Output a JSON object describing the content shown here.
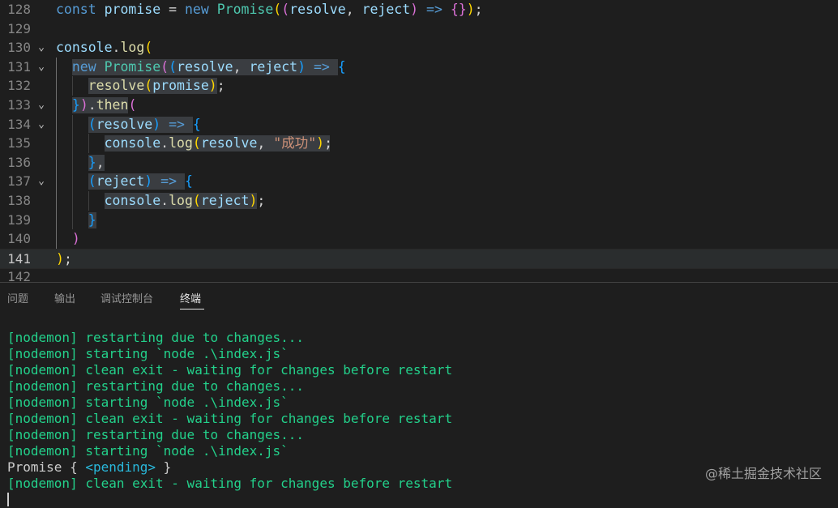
{
  "editor": {
    "lines": [
      {
        "n": "128",
        "parts": [
          [
            "k",
            "const "
          ],
          [
            "v",
            "promise"
          ],
          [
            "p",
            " = "
          ],
          [
            "k",
            "new "
          ],
          [
            "t",
            "Promise"
          ],
          [
            "b1",
            "("
          ],
          [
            "b2",
            "("
          ],
          [
            "v",
            "resolve"
          ],
          [
            "p",
            ", "
          ],
          [
            "v",
            "reject"
          ],
          [
            "b2",
            ")"
          ],
          [
            "p",
            " "
          ],
          [
            "k",
            "=>"
          ],
          [
            "p",
            " "
          ],
          [
            "b2",
            "{}"
          ],
          [
            "b1",
            ")"
          ],
          [
            "p",
            ";"
          ]
        ]
      },
      {
        "n": "129",
        "parts": []
      },
      {
        "n": "130",
        "fold": true,
        "parts": [
          [
            "v",
            "console"
          ],
          [
            "p",
            "."
          ],
          [
            "f",
            "log"
          ],
          [
            "b1",
            "("
          ]
        ]
      },
      {
        "n": "131",
        "fold": true,
        "parts": [
          [
            "p",
            "  "
          ],
          [
            "k",
            "new "
          ],
          [
            "t",
            "Promise"
          ],
          [
            "b2",
            "("
          ],
          [
            "b3",
            "("
          ],
          [
            "v",
            "resolve"
          ],
          [
            "p",
            ", "
          ],
          [
            "v",
            "reject"
          ],
          [
            "b3",
            ")"
          ],
          [
            "p",
            " "
          ],
          [
            "k",
            "=>"
          ],
          [
            "p",
            " "
          ],
          [
            "b3",
            "{"
          ]
        ]
      },
      {
        "n": "132",
        "parts": [
          [
            "p",
            "    "
          ],
          [
            "f",
            "resolve"
          ],
          [
            "b1",
            "("
          ],
          [
            "v",
            "promise"
          ],
          [
            "b1",
            ")"
          ],
          [
            "p",
            ";"
          ]
        ]
      },
      {
        "n": "133",
        "fold": true,
        "parts": [
          [
            "p",
            "  "
          ],
          [
            "b3",
            "}"
          ],
          [
            "b2",
            ")"
          ],
          [
            "p",
            "."
          ],
          [
            "f",
            "then"
          ],
          [
            "b2",
            "("
          ]
        ]
      },
      {
        "n": "134",
        "fold": true,
        "parts": [
          [
            "p",
            "    "
          ],
          [
            "b3",
            "("
          ],
          [
            "v",
            "resolve"
          ],
          [
            "b3",
            ")"
          ],
          [
            "p",
            " "
          ],
          [
            "k",
            "=>"
          ],
          [
            "p",
            " "
          ],
          [
            "b3",
            "{"
          ]
        ]
      },
      {
        "n": "135",
        "parts": [
          [
            "p",
            "      "
          ],
          [
            "v",
            "console"
          ],
          [
            "p",
            "."
          ],
          [
            "f",
            "log"
          ],
          [
            "b1",
            "("
          ],
          [
            "v",
            "resolve"
          ],
          [
            "p",
            ", "
          ],
          [
            "s",
            "\"成功\""
          ],
          [
            "b1",
            ")"
          ],
          [
            "p",
            ";"
          ]
        ]
      },
      {
        "n": "136",
        "parts": [
          [
            "p",
            "    "
          ],
          [
            "b3",
            "}"
          ],
          [
            "p",
            ","
          ]
        ]
      },
      {
        "n": "137",
        "fold": true,
        "parts": [
          [
            "p",
            "    "
          ],
          [
            "b3",
            "("
          ],
          [
            "v",
            "reject"
          ],
          [
            "b3",
            ")"
          ],
          [
            "p",
            " "
          ],
          [
            "k",
            "=>"
          ],
          [
            "p",
            " "
          ],
          [
            "b3",
            "{"
          ]
        ]
      },
      {
        "n": "138",
        "parts": [
          [
            "p",
            "      "
          ],
          [
            "v",
            "console"
          ],
          [
            "p",
            "."
          ],
          [
            "f",
            "log"
          ],
          [
            "b1",
            "("
          ],
          [
            "v",
            "reject"
          ],
          [
            "b1",
            ")"
          ],
          [
            "p",
            ";"
          ]
        ]
      },
      {
        "n": "139",
        "parts": [
          [
            "p",
            "    "
          ],
          [
            "b3",
            "}"
          ]
        ]
      },
      {
        "n": "140",
        "parts": [
          [
            "p",
            "  "
          ],
          [
            "b2",
            ")"
          ]
        ]
      },
      {
        "n": "141",
        "active": true,
        "parts": [
          [
            "b1",
            ")"
          ],
          [
            "p",
            ";"
          ]
        ]
      },
      {
        "n": "142",
        "parts": []
      }
    ]
  },
  "panel": {
    "tabs": [
      {
        "label": "问题",
        "active": false
      },
      {
        "label": "输出",
        "active": false
      },
      {
        "label": "调试控制台",
        "active": false
      },
      {
        "label": "终端",
        "active": true
      }
    ]
  },
  "terminal": {
    "lines": [
      [
        [
          "green",
          "[nodemon] restarting due to changes..."
        ]
      ],
      [
        [
          "green",
          "[nodemon] starting `node .\\index.js`"
        ]
      ],
      [
        [
          "green",
          "[nodemon] clean exit - waiting for changes before restart"
        ]
      ],
      [
        [
          "green",
          "[nodemon] restarting due to changes..."
        ]
      ],
      [
        [
          "green",
          "[nodemon] starting `node .\\index.js`"
        ]
      ],
      [
        [
          "green",
          "[nodemon] clean exit - waiting for changes before restart"
        ]
      ],
      [
        [
          "green",
          "[nodemon] restarting due to changes..."
        ]
      ],
      [
        [
          "green",
          "[nodemon] starting `node .\\index.js`"
        ]
      ],
      [
        [
          "plain",
          "Promise { "
        ],
        [
          "teal",
          "<pending>"
        ],
        [
          "plain",
          " }"
        ]
      ],
      [
        [
          "green",
          "[nodemon] clean exit - waiting for changes before restart"
        ]
      ]
    ]
  },
  "watermark": "@稀土掘金技术社区",
  "colors": {
    "accent": "#23d18b",
    "background": "#1e1e1e"
  }
}
